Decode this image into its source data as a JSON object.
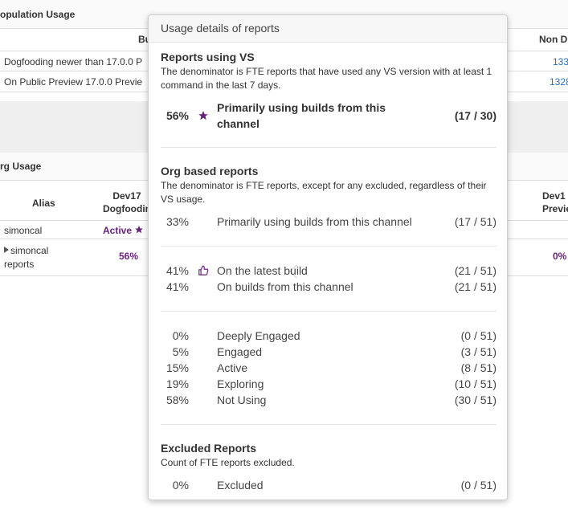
{
  "population": {
    "header": "opulation Usage",
    "col_bu": "Bu",
    "col_non": "Non D",
    "rows": [
      {
        "label": "Dogfooding newer than 17.0.0 P",
        "value": "133"
      },
      {
        "label": "On Public Preview 17.0.0 Previe",
        "value": "1328"
      }
    ]
  },
  "org": {
    "header": "rg Usage",
    "col_alias": "Alias",
    "col_dev17_line1": "Dev17",
    "col_dev17_line2": "Dogfoodin",
    "col_right_line1": "Dev1",
    "col_right_line2": "Previe",
    "row1_alias": "simoncal",
    "row1_status": "Active",
    "row2_alias_line1": "simoncal",
    "row2_alias_line2": "reports",
    "row2_pct": "56%",
    "row2_right": "0%"
  },
  "popover": {
    "title": "Usage details of reports",
    "vs": {
      "title": "Reports using VS",
      "desc": "The denominator is FTE reports that have used any VS version with at least 1 command in the last 7 days.",
      "metric": {
        "pct": "56%",
        "label_line1": "Primarily using builds from this",
        "label_line2": "channel",
        "count": "(17 / 30)"
      }
    },
    "org": {
      "title": "Org based reports",
      "desc": "The denominator is FTE reports, except for any excluded, regardless of their VS usage.",
      "primary": {
        "pct": "33%",
        "label": "Primarily using builds from this channel",
        "count": "(17 / 51)"
      },
      "latest": {
        "pct": "41%",
        "label": "On the latest build",
        "count": "(21 / 51)"
      },
      "channel": {
        "pct": "41%",
        "label": "On builds from this channel",
        "count": "(21 / 51)"
      },
      "engagement": [
        {
          "pct": "0%",
          "label": "Deeply Engaged",
          "count": "(0 / 51)"
        },
        {
          "pct": "5%",
          "label": "Engaged",
          "count": "(3 / 51)"
        },
        {
          "pct": "15%",
          "label": "Active",
          "count": "(8 / 51)"
        },
        {
          "pct": "19%",
          "label": "Exploring",
          "count": "(10 / 51)"
        },
        {
          "pct": "58%",
          "label": "Not Using",
          "count": "(30 / 51)"
        }
      ]
    },
    "excluded": {
      "title": "Excluded Reports",
      "desc": "Count of FTE reports excluded.",
      "metric": {
        "pct": "0%",
        "label": "Excluded",
        "count": "(0 / 51)"
      }
    }
  },
  "colors": {
    "accent": "#68217a",
    "link": "#2a6ebb"
  },
  "icons": {
    "star": "star-icon",
    "thumbs_up": "thumbs-up-icon",
    "expand": "caret-right-icon"
  }
}
